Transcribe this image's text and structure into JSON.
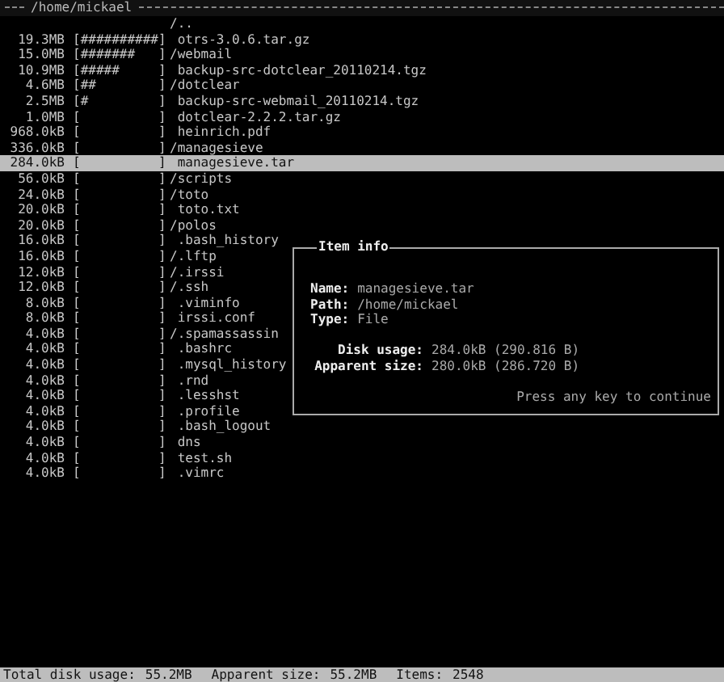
{
  "header": {
    "path": "/home/mickael"
  },
  "rows": [
    {
      "size": "",
      "graph": "",
      "name": "/..",
      "selected": false
    },
    {
      "size": "19.3MB",
      "graph": "[##########]",
      "name": " otrs-3.0.6.tar.gz",
      "selected": false
    },
    {
      "size": "15.0MB",
      "graph": "[#######   ]",
      "name": "/webmail",
      "selected": false
    },
    {
      "size": "10.9MB",
      "graph": "[#####     ]",
      "name": " backup-src-dotclear_20110214.tgz",
      "selected": false
    },
    {
      "size": "4.6MB",
      "graph": "[##        ]",
      "name": "/dotclear",
      "selected": false
    },
    {
      "size": "2.5MB",
      "graph": "[#         ]",
      "name": " backup-src-webmail_20110214.tgz",
      "selected": false
    },
    {
      "size": "1.0MB",
      "graph": "[          ]",
      "name": " dotclear-2.2.2.tar.gz",
      "selected": false
    },
    {
      "size": "968.0kB",
      "graph": "[          ]",
      "name": " heinrich.pdf",
      "selected": false
    },
    {
      "size": "336.0kB",
      "graph": "[          ]",
      "name": "/managesieve",
      "selected": false
    },
    {
      "size": "284.0kB",
      "graph": "[          ]",
      "name": " managesieve.tar",
      "selected": true
    },
    {
      "size": "56.0kB",
      "graph": "[          ]",
      "name": "/scripts",
      "selected": false
    },
    {
      "size": "24.0kB",
      "graph": "[          ]",
      "name": "/toto",
      "selected": false
    },
    {
      "size": "20.0kB",
      "graph": "[          ]",
      "name": " toto.txt",
      "selected": false
    },
    {
      "size": "20.0kB",
      "graph": "[          ]",
      "name": "/polos",
      "selected": false
    },
    {
      "size": "16.0kB",
      "graph": "[          ]",
      "name": " .bash_history",
      "selected": false
    },
    {
      "size": "16.0kB",
      "graph": "[          ]",
      "name": "/.lftp",
      "selected": false
    },
    {
      "size": "12.0kB",
      "graph": "[          ]",
      "name": "/.irssi",
      "selected": false
    },
    {
      "size": "12.0kB",
      "graph": "[          ]",
      "name": "/.ssh",
      "selected": false
    },
    {
      "size": "8.0kB",
      "graph": "[          ]",
      "name": " .viminfo",
      "selected": false
    },
    {
      "size": "8.0kB",
      "graph": "[          ]",
      "name": " irssi.conf",
      "selected": false
    },
    {
      "size": "4.0kB",
      "graph": "[          ]",
      "name": "/.spamassassin",
      "selected": false
    },
    {
      "size": "4.0kB",
      "graph": "[          ]",
      "name": " .bashrc",
      "selected": false
    },
    {
      "size": "4.0kB",
      "graph": "[          ]",
      "name": " .mysql_history",
      "selected": false
    },
    {
      "size": "4.0kB",
      "graph": "[          ]",
      "name": " .rnd",
      "selected": false
    },
    {
      "size": "4.0kB",
      "graph": "[          ]",
      "name": " .lesshst",
      "selected": false
    },
    {
      "size": "4.0kB",
      "graph": "[          ]",
      "name": " .profile",
      "selected": false
    },
    {
      "size": "4.0kB",
      "graph": "[          ]",
      "name": " .bash_logout",
      "selected": false
    },
    {
      "size": "4.0kB",
      "graph": "[          ]",
      "name": " dns",
      "selected": false
    },
    {
      "size": "4.0kB",
      "graph": "[          ]",
      "name": " test.sh",
      "selected": false
    },
    {
      "size": "4.0kB",
      "graph": "[          ]",
      "name": " .vimrc",
      "selected": false
    }
  ],
  "dialog": {
    "title": "Item info",
    "fields": [
      {
        "label": "Name:",
        "value": "managesieve.tar"
      },
      {
        "label": "Path:",
        "value": "/home/mickael"
      },
      {
        "label": "Type:",
        "value": "File"
      }
    ],
    "sizes": [
      {
        "label": "Disk usage:",
        "value": "284.0kB (290.816 B)"
      },
      {
        "label": "Apparent size:",
        "value": "280.0kB (286.720 B)"
      }
    ],
    "footer": "Press any key to continue"
  },
  "status_bar": {
    "disk_label": "Total disk usage:",
    "disk": "55.2MB",
    "apparent_label": "Apparent size:",
    "apparent": "55.2MB",
    "items_label": "Items:",
    "items": "2548"
  }
}
